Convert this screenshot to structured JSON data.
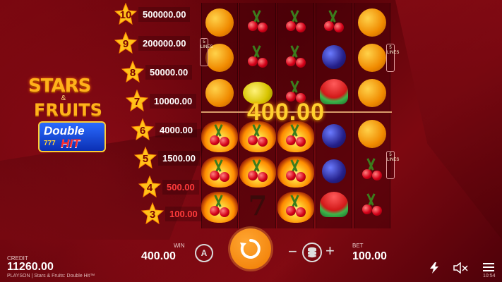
{
  "game": {
    "logo_line1": "STARS",
    "logo_amp": "&",
    "logo_line2": "FRUITS",
    "logo_badge_top": "Double",
    "logo_badge_sevens": "777",
    "logo_badge_bottom": "HIT"
  },
  "paytable": [
    {
      "stars": "10",
      "value": "500000.00",
      "highlight": false
    },
    {
      "stars": "9",
      "value": "200000.00",
      "highlight": false
    },
    {
      "stars": "8",
      "value": "50000.00",
      "highlight": false
    },
    {
      "stars": "7",
      "value": "10000.00",
      "highlight": false
    },
    {
      "stars": "6",
      "value": "4000.00",
      "highlight": false
    },
    {
      "stars": "5",
      "value": "1500.00",
      "highlight": false
    },
    {
      "stars": "4",
      "value": "500.00",
      "highlight": true
    },
    {
      "stars": "3",
      "value": "100.00",
      "highlight": true
    }
  ],
  "reels": {
    "lines_tag_left": "5 LINES",
    "lines_tag_right_top": "5 LINES",
    "lines_tag_right_bottom": "5 LINES",
    "win_amount": "400.00"
  },
  "bottom_bar": {
    "credit_label": "CREDIT",
    "credit_value": "11260.00",
    "footer_text": "PLAYSON | Stars & Fruits: Double Hit™",
    "win_label": "WIN",
    "win_value": "400.00",
    "auto_label": "A",
    "minus_label": "−",
    "plus_label": "+",
    "bet_label": "BET",
    "bet_value": "100.00",
    "clock": "10:54"
  },
  "colors": {
    "accent": "#f07a00",
    "star_gold": "#ffc21a",
    "win_gold": "#ffcf2e",
    "highlight_red": "#ff3b3b"
  },
  "icons": {
    "spin": "spin-arrow-icon",
    "auto": "autoplay-icon",
    "coins": "coin-stack-icon",
    "turbo": "lightning-icon",
    "sound": "speaker-muted-icon",
    "menu": "hamburger-menu-icon"
  }
}
